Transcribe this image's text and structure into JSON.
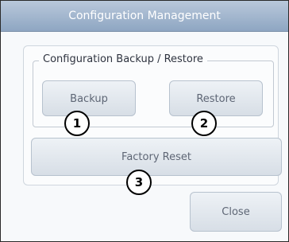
{
  "dialog": {
    "title": "Configuration Management",
    "group_legend": "Configuration Backup / Restore",
    "buttons": {
      "backup": "Backup",
      "restore": "Restore",
      "factory_reset": "Factory Reset",
      "close": "Close"
    }
  },
  "markers": [
    "1",
    "2",
    "3"
  ],
  "colors": {
    "titlebar": "#9fb4cc",
    "button": "#e3e8ee",
    "marker_border": "#000000"
  }
}
